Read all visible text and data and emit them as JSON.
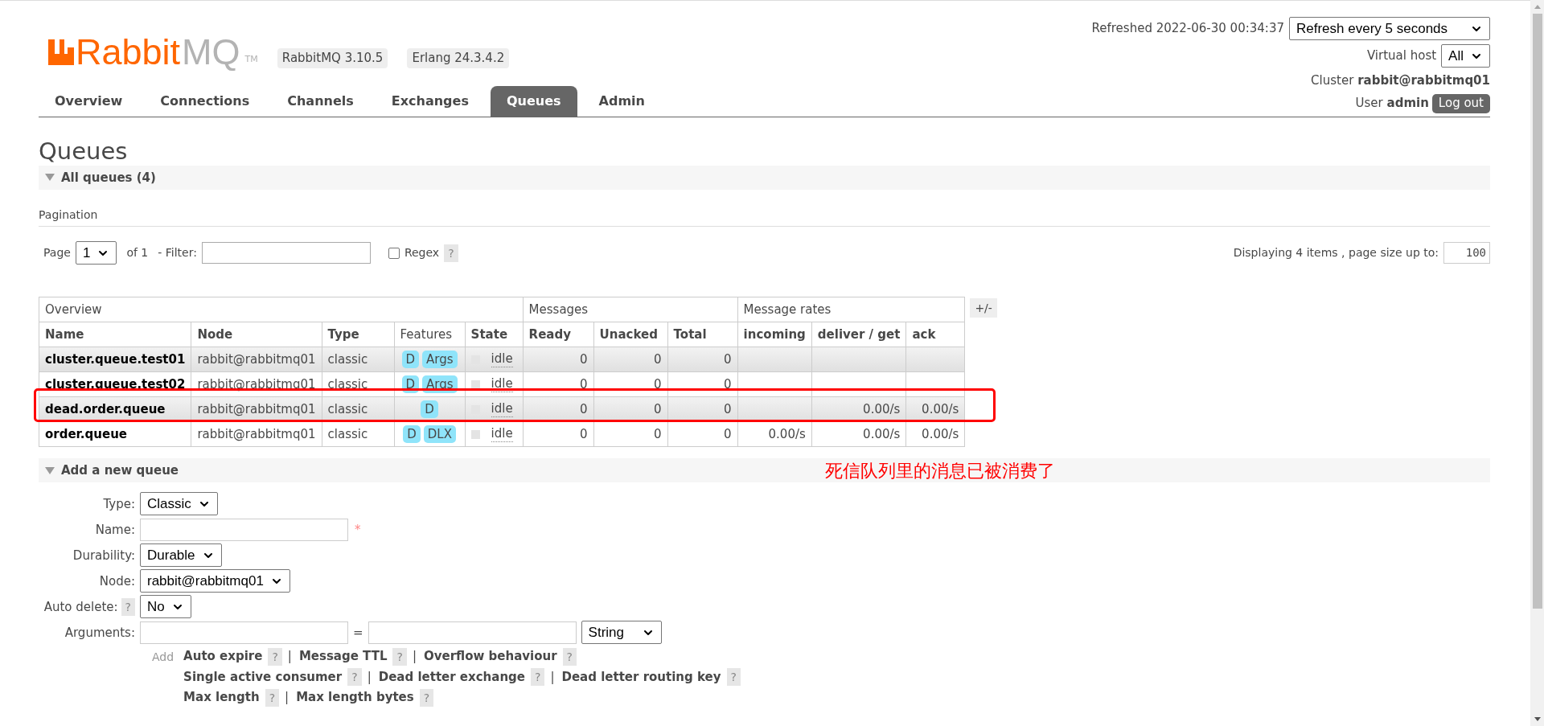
{
  "header": {
    "logo": {
      "word_a": "Rabbit",
      "word_b": "MQ",
      "tm": "TM"
    },
    "versions": [
      "RabbitMQ 3.10.5",
      "Erlang 24.3.4.2"
    ],
    "refreshed": "Refreshed 2022-06-30 00:34:37",
    "refresh_select": "Refresh every 5 seconds",
    "vhost_label": "Virtual host",
    "vhost_select": "All",
    "cluster_label": "Cluster",
    "cluster": "rabbit@rabbitmq01",
    "user_label": "User",
    "user": "admin",
    "logout": "Log out"
  },
  "tabs": [
    {
      "label": "Overview",
      "selected": false
    },
    {
      "label": "Connections",
      "selected": false
    },
    {
      "label": "Channels",
      "selected": false
    },
    {
      "label": "Exchanges",
      "selected": false
    },
    {
      "label": "Queues",
      "selected": true
    },
    {
      "label": "Admin",
      "selected": false
    }
  ],
  "page_title": "Queues",
  "all_queues": {
    "title": "All queues (4)",
    "expanded": true
  },
  "pagination": {
    "heading": "Pagination",
    "page_label": "Page",
    "page": "1",
    "of": "of 1",
    "filter_label": "- Filter:",
    "regex_label": "Regex",
    "regex_checked": false,
    "help": "?",
    "displaying": "Displaying 4 items , page size up to:",
    "page_size": "100"
  },
  "table": {
    "groups": [
      "Overview",
      "Messages",
      "Message rates"
    ],
    "toggle": "+/-",
    "columns": [
      "Name",
      "Node",
      "Type",
      "Features",
      "State",
      "Ready",
      "Unacked",
      "Total",
      "incoming",
      "deliver / get",
      "ack"
    ],
    "rows": [
      {
        "name": "cluster.queue.test01",
        "node": "rabbit@rabbitmq01",
        "type": "classic",
        "features": [
          "D",
          "Args"
        ],
        "state": "idle",
        "ready": "0",
        "unacked": "0",
        "total": "0",
        "incoming": "",
        "deliver_get": "",
        "ack": "",
        "circled": false
      },
      {
        "name": "cluster.queue.test02",
        "node": "rabbit@rabbitmq01",
        "type": "classic",
        "features": [
          "D",
          "Args"
        ],
        "state": "idle",
        "ready": "0",
        "unacked": "0",
        "total": "0",
        "incoming": "",
        "deliver_get": "",
        "ack": "",
        "circled": false
      },
      {
        "name": "dead.order.queue",
        "node": "rabbit@rabbitmq01",
        "type": "classic",
        "features": [
          "D"
        ],
        "state": "idle",
        "ready": "0",
        "unacked": "0",
        "total": "0",
        "incoming": "",
        "deliver_get": "0.00/s",
        "ack": "0.00/s",
        "circled": true
      },
      {
        "name": "order.queue",
        "node": "rabbit@rabbitmq01",
        "type": "classic",
        "features": [
          "D",
          "DLX"
        ],
        "state": "idle",
        "ready": "0",
        "unacked": "0",
        "total": "0",
        "incoming": "0.00/s",
        "deliver_get": "0.00/s",
        "ack": "0.00/s",
        "circled": false
      }
    ]
  },
  "annotation": "死信队列里的消息已被消费了",
  "add_queue": {
    "title": "Add a new queue",
    "expanded": true,
    "fields": [
      {
        "kind": "select",
        "label": "Type:",
        "value": "Classic"
      },
      {
        "kind": "input",
        "label": "Name:",
        "required": "*"
      },
      {
        "kind": "select",
        "label": "Durability:",
        "value": "Durable"
      },
      {
        "kind": "select",
        "label": "Node:",
        "value": "rabbit@rabbitmq01"
      },
      {
        "kind": "select",
        "label": "Auto delete:",
        "help": "?",
        "value": "No"
      },
      {
        "kind": "arguments",
        "label": "Arguments:",
        "equals": "=",
        "value": "String"
      }
    ],
    "add": "Add",
    "arg_links": [
      [
        {
          "label": "Auto expire",
          "help": "?"
        },
        {
          "label": "Message TTL",
          "help": "?"
        },
        {
          "label": "Overflow behaviour",
          "help": "?"
        }
      ],
      [
        {
          "label": "Single active consumer",
          "help": "?"
        },
        {
          "label": "Dead letter exchange",
          "help": "?"
        },
        {
          "label": "Dead letter routing key",
          "help": "?"
        }
      ],
      [
        {
          "label": "Max length",
          "help": "?"
        },
        {
          "label": "Max length bytes",
          "help": "?"
        }
      ]
    ],
    "separator": "|"
  }
}
